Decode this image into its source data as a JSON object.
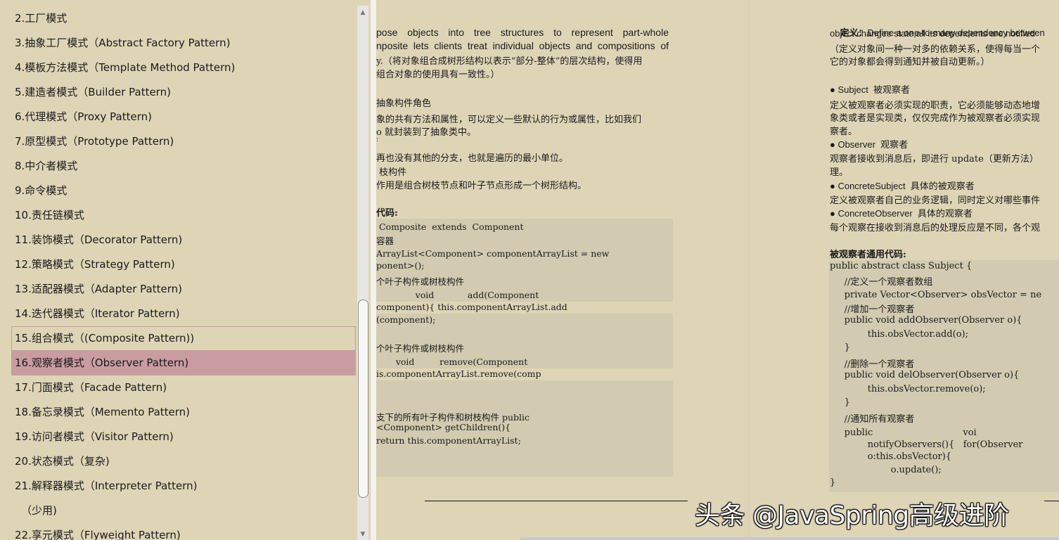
{
  "sidebar": {
    "items": [
      {
        "label": "2.工厂模式"
      },
      {
        "label": "3.抽象工厂模式（Abstract Factory Pattern)"
      },
      {
        "label": "4.模板方法模式（Template Method Pattern)"
      },
      {
        "label": "5.建造者模式（Builder Pattern)"
      },
      {
        "label": "6.代理模式（Proxy Pattern)"
      },
      {
        "label": "7.原型模式（Prototype Pattern)"
      },
      {
        "label": "8.中介者模式"
      },
      {
        "label": "9.命令模式"
      },
      {
        "label": "10.责任链模式"
      },
      {
        "label": "11.装饰模式（Decorator Pattern)"
      },
      {
        "label": "12.策略模式（Strategy Pattern)"
      },
      {
        "label": "13.适配器模式（Adapter Pattern)"
      },
      {
        "label": "14.迭代器模式（Iterator Pattern)"
      },
      {
        "label": "15.组合模式（(Composite Pattern))"
      },
      {
        "label": "16.观察者模式（Observer Pattern)"
      },
      {
        "label": "17.门面模式（Facade Pattern)"
      },
      {
        "label": "18.备忘录模式（Memento Pattern)"
      },
      {
        "label": "19.访问者模式（Visitor Pattern)"
      },
      {
        "label": "20.状态模式（复杂)"
      },
      {
        "label": "21.解释器模式（Interpreter Pattern)"
      },
      {
        "label": "（少用)"
      },
      {
        "label": "22.享元模式（Flyweight Pattern)"
      }
    ],
    "hovered_index": 13,
    "selected_index": 14,
    "scroll_up": "▲",
    "scroll_down": "▼"
  },
  "page1": {
    "lines": [
      "pose  objects  into  tree  structures  to  represent  part-whole",
      "nposite lets clients treat individual objects and compositions of",
      "y.（将对象组合成树形结构以表示“部分-整体”的层次结构，使得用",
      "组合对象的使用具有一致性。）",
      "抽象构件角色",
      "象的共有方法和属性，可以定义一些默认的行为或属性，比如我们",
      "o 就封装到了抽象类中。",
      ":",
      "再也没有其他的分支，也就是遍历的最小单位。",
      " 枝构件",
      "作用是组合树枝节点和叶子节点形成一个树形结构。",
      "代码:"
    ],
    "code": [
      " Composite  extends  Component",
      "容器",
      "ArrayList<Component> componentArrayList = new",
      "ponent>();",
      "个叶子构件或树枝构件",
      "              void            add(Component",
      "component){ this.componentArrayList.add",
      "(component);",
      "个叶子构件或树枝构件",
      "       void         remove(Component",
      "is.componentArrayList.remove(comp",
      "支下的所有叶子构件和树枝构件 public",
      "<Component> getChildren(){",
      "return this.componentArrayList;"
    ]
  },
  "page2": {
    "def_label": "定义：",
    "lines": [
      "Define a one-to-many dependency between",
      "object changes state,all its dependents are notified",
      "（定义对象间一种一对多的依赖关系，使得每当一个",
      "它的对象都会得到通知并被自动更新。）",
      "● Subject  被观察者",
      "定义被观察者必须实现的职责，它必须能够动态地增",
      "象类或者是实现类，仅仅完成作为被观察者必须实现",
      "察者。",
      "● Observer  观察者",
      "观察者接收到消息后，即进行 update（更新方法）",
      "理。",
      "● ConcreteSubject  具体的被观察者",
      "定义被观察者自己的业务逻辑，同时定义对哪些事件",
      "● ConcreteObserver  具体的观察者",
      "每个观察在接收到消息后的处理反应是不同，各个观",
      "被观察者通用代码:"
    ],
    "code": [
      "public abstract class Subject {",
      "     //定义一个观察者数组",
      "     private Vector<Observer> obsVector = ne",
      "     //增加一个观察者",
      "     public void addObserver(Observer o){",
      "             this.obsVector.add(o);",
      "     }",
      "     //删除一个观察者",
      "     public void delObserver(Observer o){",
      "             this.obsVector.remove(o);",
      "     }",
      "     //通知所有观察者",
      "     public                               voi",
      "             notifyObservers(){   for(Observer",
      "             o:this.obsVector){",
      "                     o.update();",
      "}"
    ]
  },
  "watermark": "头条 @JavaSpring高级进阶"
}
